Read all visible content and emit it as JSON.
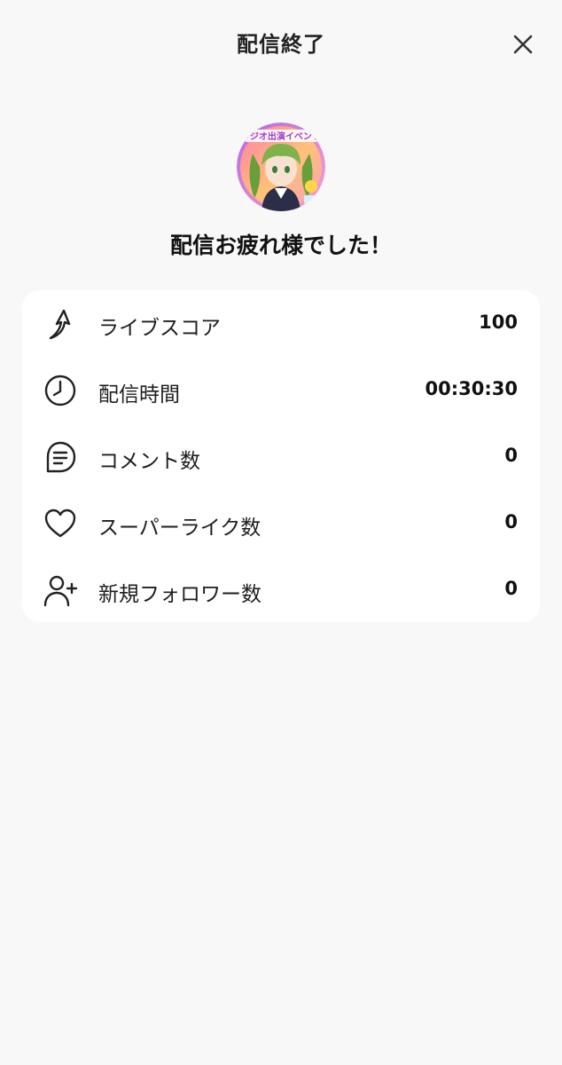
{
  "header": {
    "title": "配信終了",
    "close_icon": "close-icon"
  },
  "profile": {
    "avatar_banner_text": "ラジオ出演イベント",
    "message": "配信お疲れ様でした！"
  },
  "stats": [
    {
      "icon": "arrow-up-icon",
      "label": "ライブスコア",
      "value": "100"
    },
    {
      "icon": "clock-icon",
      "label": "配信時間",
      "value": "00:30:30"
    },
    {
      "icon": "comment-icon",
      "label": "コメント数",
      "value": "0"
    },
    {
      "icon": "heart-icon",
      "label": "スーパーライク数",
      "value": "0"
    },
    {
      "icon": "user-plus-icon",
      "label": "新規フォロワー数",
      "value": "0"
    }
  ],
  "colors": {
    "background": "#f8f8f8",
    "card": "#ffffff",
    "text": "#1a1a1a"
  }
}
